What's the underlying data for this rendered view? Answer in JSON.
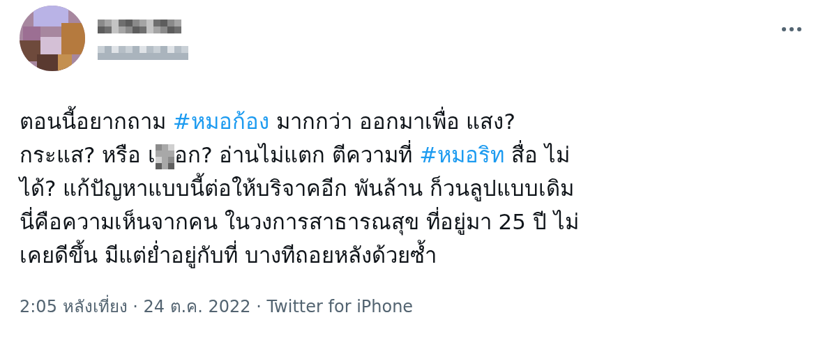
{
  "tweet": {
    "body_lines": [
      [
        {
          "kind": "text",
          "text": "ตอนนี้อยากถาม "
        },
        {
          "kind": "hashtag",
          "text": "#หมอก้อง"
        },
        {
          "kind": "text",
          "text": " มากกว่า ออกมาเพื่อ แสง?"
        }
      ],
      [
        {
          "kind": "text",
          "text": "กระแส? หรือ เ"
        },
        {
          "kind": "censor"
        },
        {
          "kind": "text",
          "text": "อก? อ่านไม่แตก ตีความที่ "
        },
        {
          "kind": "hashtag",
          "text": "#หมอริท"
        },
        {
          "kind": "text",
          "text": " สื่อ ไม่"
        }
      ],
      [
        {
          "kind": "text",
          "text": "ได้? แก้ปัญหาแบบนี้ต่อให้บริจาคอีก พันล้าน ก็วนลูปแบบเดิม"
        }
      ],
      [
        {
          "kind": "text",
          "text": "นี่คือความเห็นจากคน ในวงการสาธารณสุข ที่อยู่มา 25 ปี ไม่"
        }
      ],
      [
        {
          "kind": "text",
          "text": "เคยดีขึ้น มีแต่ย่ำอยู่กับที่ บางทีถอยหลังด้วยซ้ำ"
        }
      ]
    ],
    "meta": "2:05 หลังเที่ยง · 24 ต.ค. 2022 · Twitter for iPhone"
  }
}
